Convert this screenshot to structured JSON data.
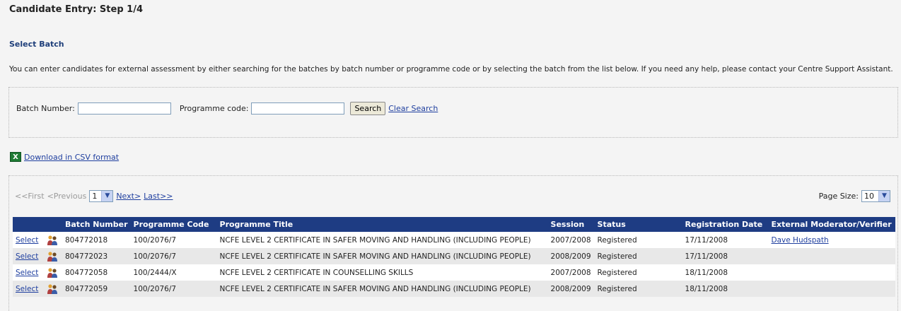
{
  "page": {
    "title": "Candidate Entry: Step 1/4",
    "section_title": "Select Batch",
    "intro": "You can enter candidates for external assessment by either searching for the batches by batch number or programme code or by selecting the batch from the list below. If you need any help, please contact your Centre Support Assistant."
  },
  "search": {
    "batch_label": "Batch Number:",
    "batch_value": "",
    "programme_label": "Programme code:",
    "programme_value": "",
    "search_button": "Search",
    "clear_link": "Clear Search"
  },
  "download": {
    "label": "Download in CSV format",
    "icon": "excel-icon"
  },
  "pager": {
    "first": "<<First",
    "previous": "<Previous",
    "page": "1",
    "next": "Next>",
    "last": "Last>>",
    "page_size_label": "Page Size:",
    "page_size": "10"
  },
  "table": {
    "headers": [
      "",
      "",
      "Batch Number",
      "Programme Code",
      "Programme Title",
      "Session",
      "Status",
      "Registration Date",
      "External Moderator/Verifier"
    ],
    "rows": [
      {
        "select": "Select",
        "batch": "804772018",
        "code": "100/2076/7",
        "title": "NCFE LEVEL 2 CERTIFICATE IN SAFER MOVING AND HANDLING (INCLUDING PEOPLE)",
        "session": "2007/2008",
        "status": "Registered",
        "date": "17/11/2008",
        "moderator": "Dave Hudspath"
      },
      {
        "select": "Select",
        "batch": "804772023",
        "code": "100/2076/7",
        "title": "NCFE LEVEL 2 CERTIFICATE IN SAFER MOVING AND HANDLING (INCLUDING PEOPLE)",
        "session": "2008/2009",
        "status": "Registered",
        "date": "17/11/2008",
        "moderator": ""
      },
      {
        "select": "Select",
        "batch": "804772058",
        "code": "100/2444/X",
        "title": "NCFE LEVEL 2 CERTIFICATE IN COUNSELLING SKILLS",
        "session": "2007/2008",
        "status": "Registered",
        "date": "18/11/2008",
        "moderator": ""
      },
      {
        "select": "Select",
        "batch": "804772059",
        "code": "100/2076/7",
        "title": "NCFE LEVEL 2 CERTIFICATE IN SAFER MOVING AND HANDLING (INCLUDING PEOPLE)",
        "session": "2008/2009",
        "status": "Registered",
        "date": "18/11/2008",
        "moderator": ""
      }
    ]
  },
  "colors": {
    "header_bg": "#1e3c83",
    "link": "#1f3f9f",
    "section_title": "#1f3f7a",
    "alt_row": "#e8e8e8"
  }
}
